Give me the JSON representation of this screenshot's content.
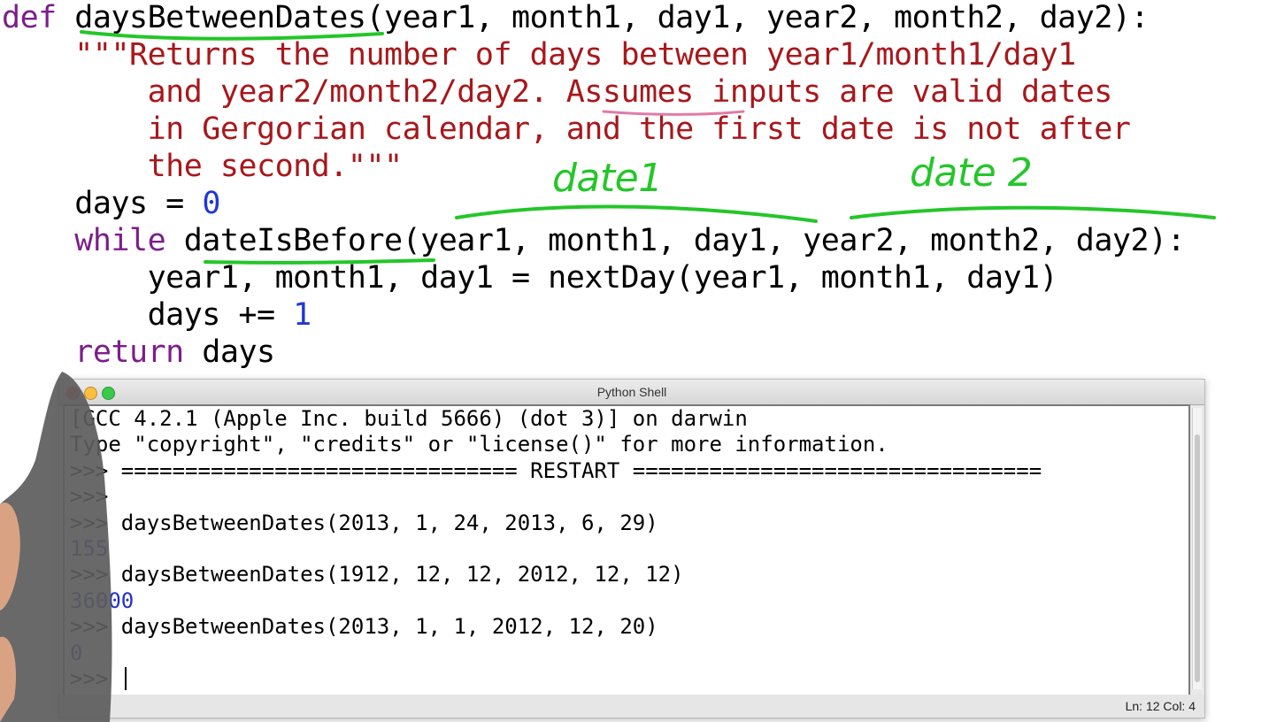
{
  "code_lines": [
    {
      "indent": "",
      "parts": [
        {
          "t": "def ",
          "c": "kw"
        },
        {
          "t": "daysBetweenDates",
          "c": "fn"
        },
        {
          "t": "(year1, month1, day1, year2, month2, day2):",
          "c": "tx"
        }
      ]
    },
    {
      "indent": "    ",
      "parts": [
        {
          "t": "\"\"\"Returns the number of days between year1/month1/day1",
          "c": "st"
        }
      ]
    },
    {
      "indent": "        ",
      "parts": [
        {
          "t": "and year2/month2/day2. Assumes inputs are valid dates",
          "c": "st"
        }
      ]
    },
    {
      "indent": "        ",
      "parts": [
        {
          "t": "in Gergorian calendar, and the first date is not after",
          "c": "st"
        }
      ]
    },
    {
      "indent": "        ",
      "parts": [
        {
          "t": "the second.\"\"\"",
          "c": "st"
        }
      ]
    },
    {
      "indent": "    ",
      "parts": [
        {
          "t": "days = ",
          "c": "tx"
        },
        {
          "t": "0",
          "c": "nm"
        }
      ]
    },
    {
      "indent": "    ",
      "parts": [
        {
          "t": "while ",
          "c": "kw"
        },
        {
          "t": "dateIsBefore(year1, month1, day1, year2, month2, day2):",
          "c": "tx"
        }
      ]
    },
    {
      "indent": "        ",
      "parts": [
        {
          "t": "year1, month1, day1 = nextDay(year1, month1, day1)",
          "c": "tx"
        }
      ]
    },
    {
      "indent": "        ",
      "parts": [
        {
          "t": "days += ",
          "c": "tx"
        },
        {
          "t": "1",
          "c": "nm"
        }
      ]
    },
    {
      "indent": "    ",
      "parts": [
        {
          "t": "return",
          "c": "kw"
        },
        {
          "t": " days",
          "c": "tx"
        }
      ]
    }
  ],
  "annotations": {
    "date1": "date1",
    "date2": "date 2"
  },
  "shell": {
    "title": "Python Shell",
    "lines": [
      {
        "t": "[GCC 4.2.1 (Apple Inc. build 5666) (dot 3)] on darwin",
        "c": "prompt"
      },
      {
        "t": "Type \"copyright\", \"credits\" or \"license()\" for more information.",
        "c": "prompt"
      },
      {
        "t": ">>> =============================== RESTART ================================",
        "c": "prompt"
      },
      {
        "t": ">>> ",
        "c": "prompt"
      },
      {
        "t": ">>> daysBetweenDates(2013, 1, 24, 2013, 6, 29)",
        "c": "prompt"
      },
      {
        "t": "155",
        "c": "out"
      },
      {
        "t": ">>> daysBetweenDates(1912, 12, 12, 2012, 12, 12)",
        "c": "prompt"
      },
      {
        "t": "36000",
        "c": "out"
      },
      {
        "t": ">>> daysBetweenDates(2013, 1, 1, 2012, 12, 20)",
        "c": "prompt"
      },
      {
        "t": "0",
        "c": "out"
      },
      {
        "t": ">>> ",
        "c": "prompt",
        "cursor": true
      }
    ],
    "status": "Ln: 12 Col: 4"
  },
  "colors": {
    "keyword": "#7b1e8a",
    "string": "#a8171b",
    "number": "#1f39d6",
    "ink": "#24c629",
    "shell_output": "#2330c9"
  }
}
